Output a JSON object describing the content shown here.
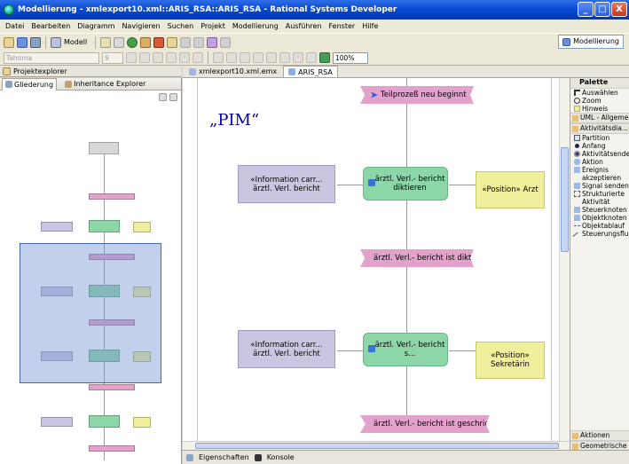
{
  "window": {
    "title": "Modellierung - xmlexport10.xml::ARIS_RSA::ARIS_RSA - Rational Systems Developer",
    "btn_min": "_",
    "btn_max": "□",
    "btn_close": "X"
  },
  "menu": [
    "Datei",
    "Bearbeiten",
    "Diagramm",
    "Navigieren",
    "Suchen",
    "Projekt",
    "Modellierung",
    "Ausführen",
    "Fenster",
    "Hilfe"
  ],
  "toolbar": {
    "modell_label": "Modell",
    "perspective_label": "Modellierung",
    "font_name": "Tahoma",
    "font_size": "9",
    "zoom": "100%"
  },
  "left": {
    "project_explorer_tab": "Projektexplorer",
    "outline_tab": "Gliederung",
    "inheritance_tab": "Inheritance Explorer"
  },
  "editor": {
    "tabs": [
      "xmlexport10.xml.emx",
      "ARIS_RSA"
    ],
    "title": "„PIM“",
    "events": [
      "Teilprozeß neu beginnt",
      "ärztl. Verl.- bericht ist diktiert",
      "ärztl. Verl.- bericht ist geschrieben"
    ],
    "functions": [
      "ärztl. Verl.- bericht diktieren",
      "ärztl. Verl.- bericht s..."
    ],
    "infos": [
      "«Information carr... ärztl. Verl. bericht",
      "«Information carr... ärztl. Verl. bericht"
    ],
    "positions": [
      "«Position» Arzt",
      "«Position» Sekretärin"
    ]
  },
  "palette": {
    "title": "Palette",
    "tools": [
      "Auswählen",
      "Zoom",
      "Hinweis"
    ],
    "drawers": [
      "UML - Allgemein",
      "Aktivitätsdia..."
    ],
    "items": [
      "Partition",
      "Anfang",
      "Aktivitätsende",
      "Aktion",
      "Ereignis akzeptieren",
      "Signal senden",
      "Strukturierte Aktivität",
      "Steuerknoten",
      "Objektknoten",
      "Objektablauf",
      "Steuerungsfluss"
    ],
    "bottom_drawers": [
      "Aktionen",
      "Geometrische F..."
    ]
  },
  "bottom": {
    "tabs": [
      "Eigenschaften",
      "Konsole"
    ]
  }
}
